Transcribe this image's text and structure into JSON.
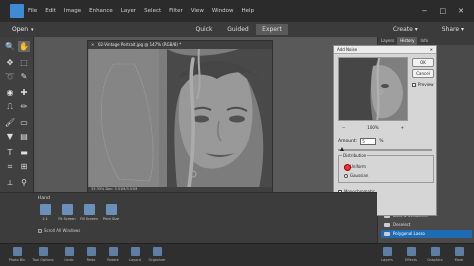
{
  "menubar": {
    "items": [
      "File",
      "Edit",
      "Image",
      "Enhance",
      "Layer",
      "Select",
      "Filter",
      "View",
      "Window",
      "Help"
    ]
  },
  "modebar": {
    "open_label": "Open",
    "modes": [
      "Quick",
      "Guided",
      "Expert"
    ],
    "active_mode": "Expert",
    "create_label": "Create",
    "share_label": "Share"
  },
  "document": {
    "title": "02-Vintage Portrait.jpg @ 147% (RGB/8) *",
    "status": "33.33% Doc: 3.51M/3.51M"
  },
  "dialog": {
    "title": "Add Noise",
    "ok_label": "OK",
    "cancel_label": "Cancel",
    "preview_label": "Preview",
    "zoom_out": "−",
    "zoom_level": "100%",
    "zoom_in": "+",
    "amount_label": "Amount:",
    "amount_value": "5",
    "amount_unit": "%",
    "slider_fraction": 0.05,
    "distribution_label": "Distribution",
    "uniform_label": "Uniform",
    "gaussian_label": "Gaussian",
    "monochromatic_label": "Monochromatic",
    "distribution_selected": "Uniform",
    "preview_checked": true,
    "monochromatic_checked": false
  },
  "rightpanel": {
    "tabs": [
      "Layers",
      "History",
      "Info"
    ],
    "active_tab": "History",
    "history": [
      "Clone Stamp",
      "Clone Stamp",
      "Polygonal Lasso",
      "Dust & Scratches",
      "Deselect",
      "Polygonal Lasso"
    ],
    "selected_history": "Polygonal Lasso"
  },
  "tooloptions": {
    "tool_name": "Hand",
    "zoom_value": "1:1",
    "buttons": [
      "Fit Screen",
      "Fill Screen",
      "Print Size"
    ],
    "scroll_all_label": "Scroll All Windows"
  },
  "taskbar": {
    "items": [
      "Photo Bin",
      "Tool Options",
      "Undo",
      "Redo",
      "Rotate",
      "Layout",
      "Organizer"
    ],
    "right_items": [
      "Layers",
      "Effects",
      "Graphics",
      "More"
    ]
  },
  "colors": {
    "accent": "#1f6cb5",
    "dialog_bg": "#d6d6d6",
    "workspace": "#595959"
  }
}
